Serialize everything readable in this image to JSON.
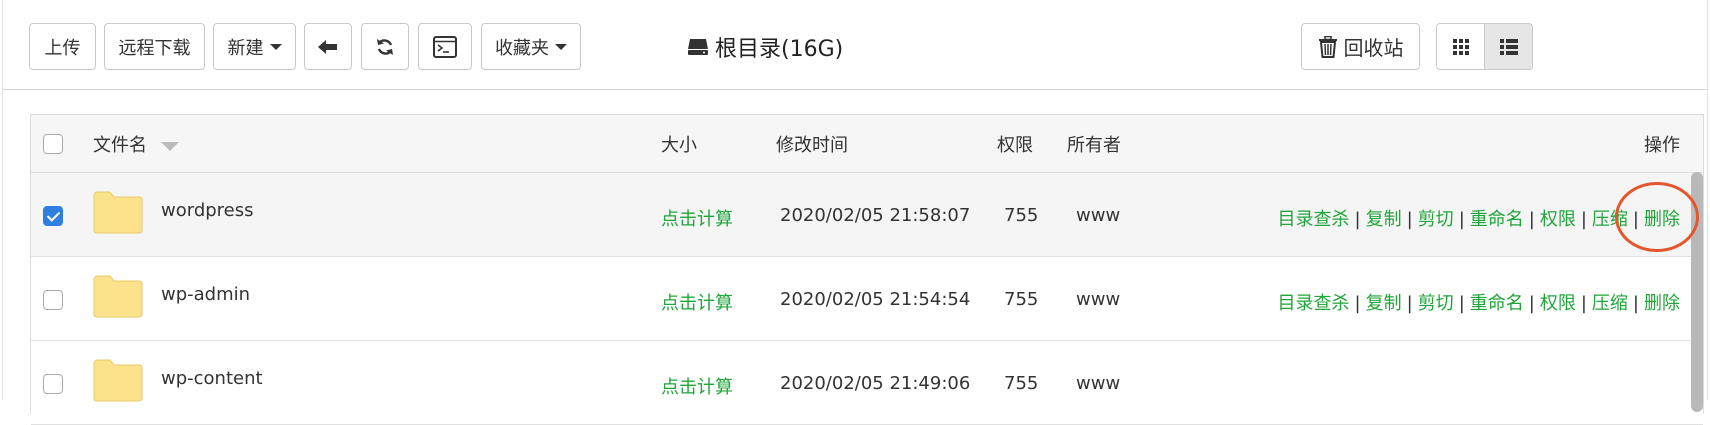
{
  "toolbar": {
    "upload": "上传",
    "remote_download": "远程下载",
    "new": "新建",
    "favorites": "收藏夹",
    "path": "根目录(16G)",
    "recycle_bin": "回收站"
  },
  "table": {
    "headers": {
      "filename": "文件名",
      "size": "大小",
      "mtime": "修改时间",
      "perm": "权限",
      "owner": "所有者",
      "ops": "操作"
    },
    "rows": [
      {
        "name": "wordpress",
        "size": "点击计算",
        "mtime": "2020/02/05 21:58:07",
        "perm": "755",
        "owner": "www",
        "checked": true
      },
      {
        "name": "wp-admin",
        "size": "点击计算",
        "mtime": "2020/02/05 21:54:54",
        "perm": "755",
        "owner": "www",
        "checked": false
      },
      {
        "name": "wp-content",
        "size": "点击计算",
        "mtime": "2020/02/05 21:49:06",
        "perm": "755",
        "owner": "www",
        "checked": false
      }
    ],
    "ops": {
      "scan": "目录查杀",
      "copy": "复制",
      "cut": "剪切",
      "rename": "重命名",
      "perm": "权限",
      "compress": "压缩",
      "delete": "删除",
      "sep": "|"
    }
  },
  "colors": {
    "accent_green": "#20a53a",
    "checkbox_blue": "#2f7fe0",
    "annotation_red": "#e4572e"
  }
}
